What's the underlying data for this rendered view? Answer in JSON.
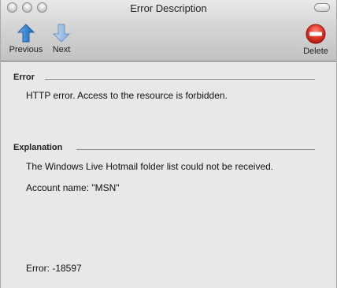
{
  "window": {
    "title": "Error Description"
  },
  "toolbar": {
    "previous_label": "Previous",
    "next_label": "Next",
    "delete_label": "Delete"
  },
  "error_section": {
    "heading": "Error",
    "message": "HTTP error. Access to the resource is forbidden."
  },
  "explanation_section": {
    "heading": "Explanation",
    "message": "The Windows Live Hotmail folder list could not be received.",
    "account_line": "Account name: \"MSN\""
  },
  "error_code": "Error: -18597",
  "colors": {
    "arrow_blue": "#3a86d6",
    "delete_red": "#d42a20"
  },
  "icons": {
    "previous": "up-arrow-icon",
    "next": "down-arrow-icon",
    "delete": "no-entry-icon"
  }
}
